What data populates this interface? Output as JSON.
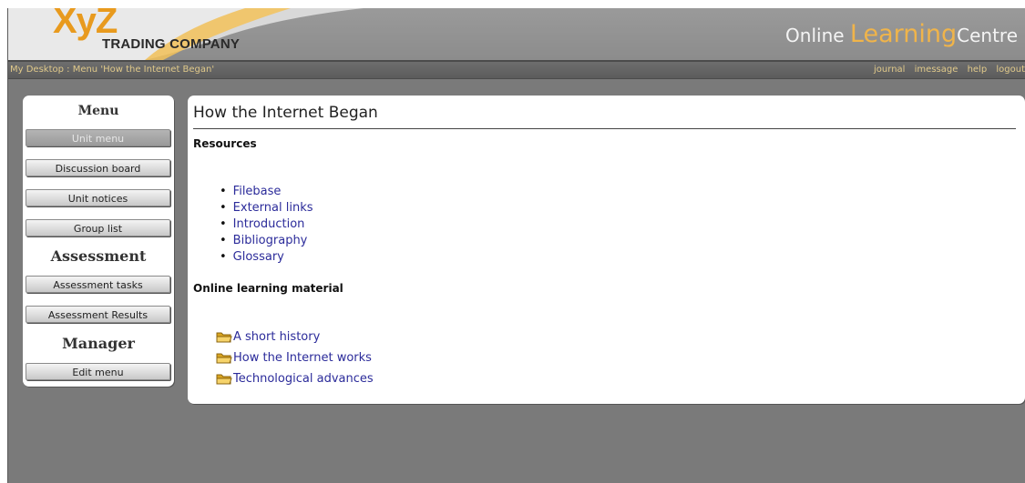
{
  "header": {
    "logo_main": "XyZ",
    "logo_sub": "TRADING COMPANY",
    "site_title_prefix": "Online",
    "site_title_big": "Learning",
    "site_title_suffix": "Centre",
    "accent_color": "#e89a1e"
  },
  "breadcrumb": "My Desktop : Menu 'How the Internet Began'",
  "top_links": [
    "journal",
    "imessage",
    "help",
    "logout"
  ],
  "sidebar": {
    "menu_heading": "Menu",
    "menu_items": [
      {
        "label": "Unit menu",
        "state": "disabled"
      },
      {
        "label": "Discussion board"
      },
      {
        "label": "Unit notices"
      },
      {
        "label": "Group list"
      }
    ],
    "assessment_heading": "Assessment",
    "assessment_items": [
      {
        "label": "Assessment tasks"
      },
      {
        "label": "Assessment Results"
      }
    ],
    "manager_heading": "Manager",
    "manager_items": [
      {
        "label": "Edit menu"
      }
    ]
  },
  "main": {
    "title": "How the Internet Began",
    "resources_heading": "Resources",
    "resources": [
      "Filebase",
      "External links",
      "Introduction",
      "Bibliography",
      "Glossary"
    ],
    "learning_heading": "Online learning material",
    "learning_items": [
      {
        "label": "A short history",
        "icon": "folder-icon"
      },
      {
        "label": "How the Internet works",
        "icon": "folder-icon"
      },
      {
        "label": "Technological advances",
        "icon": "folder-icon"
      }
    ],
    "link_color": "#2b2b9a"
  }
}
